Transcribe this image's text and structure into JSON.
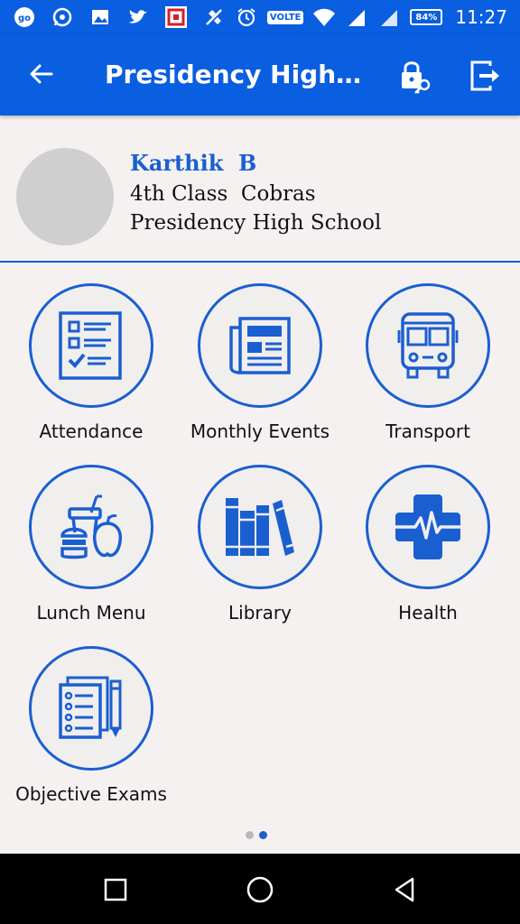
{
  "status_bar": {
    "time": "11:27",
    "battery": "84%",
    "volte": "VOLTE",
    "left_icons": [
      "go-icon",
      "whatsapp-icon",
      "image-icon",
      "twitter-icon",
      "app-icon",
      "satellite-icon"
    ],
    "right_icons": [
      "alarm-icon",
      "volte-icon",
      "wifi-icon",
      "signal-icon",
      "signal-2-icon",
      "battery-icon"
    ]
  },
  "app_bar": {
    "title": "Presidency High S...",
    "back_icon": "arrow-left-icon",
    "lock_icon": "lock-key-icon",
    "logout_icon": "logout-icon",
    "color": "#0a5ee0"
  },
  "profile": {
    "name": "Karthik  B",
    "class": "4th Class  Cobras",
    "school": "Presidency High School"
  },
  "menu": [
    {
      "label": "Attendance",
      "icon": "checklist-icon"
    },
    {
      "label": "Monthly Events",
      "icon": "newspaper-icon"
    },
    {
      "label": "Transport",
      "icon": "bus-icon"
    },
    {
      "label": "Lunch Menu",
      "icon": "food-icon"
    },
    {
      "label": "Library",
      "icon": "books-icon"
    },
    {
      "label": "Health",
      "icon": "medical-cross-icon"
    },
    {
      "label": "Objective Exams",
      "icon": "exam-sheet-icon"
    }
  ],
  "pager": {
    "current": 2,
    "total": 2
  },
  "nav_bar": {
    "icons": [
      "recent-apps-icon",
      "home-icon",
      "back-triangle-icon"
    ]
  },
  "accent": "#1a5fd0"
}
